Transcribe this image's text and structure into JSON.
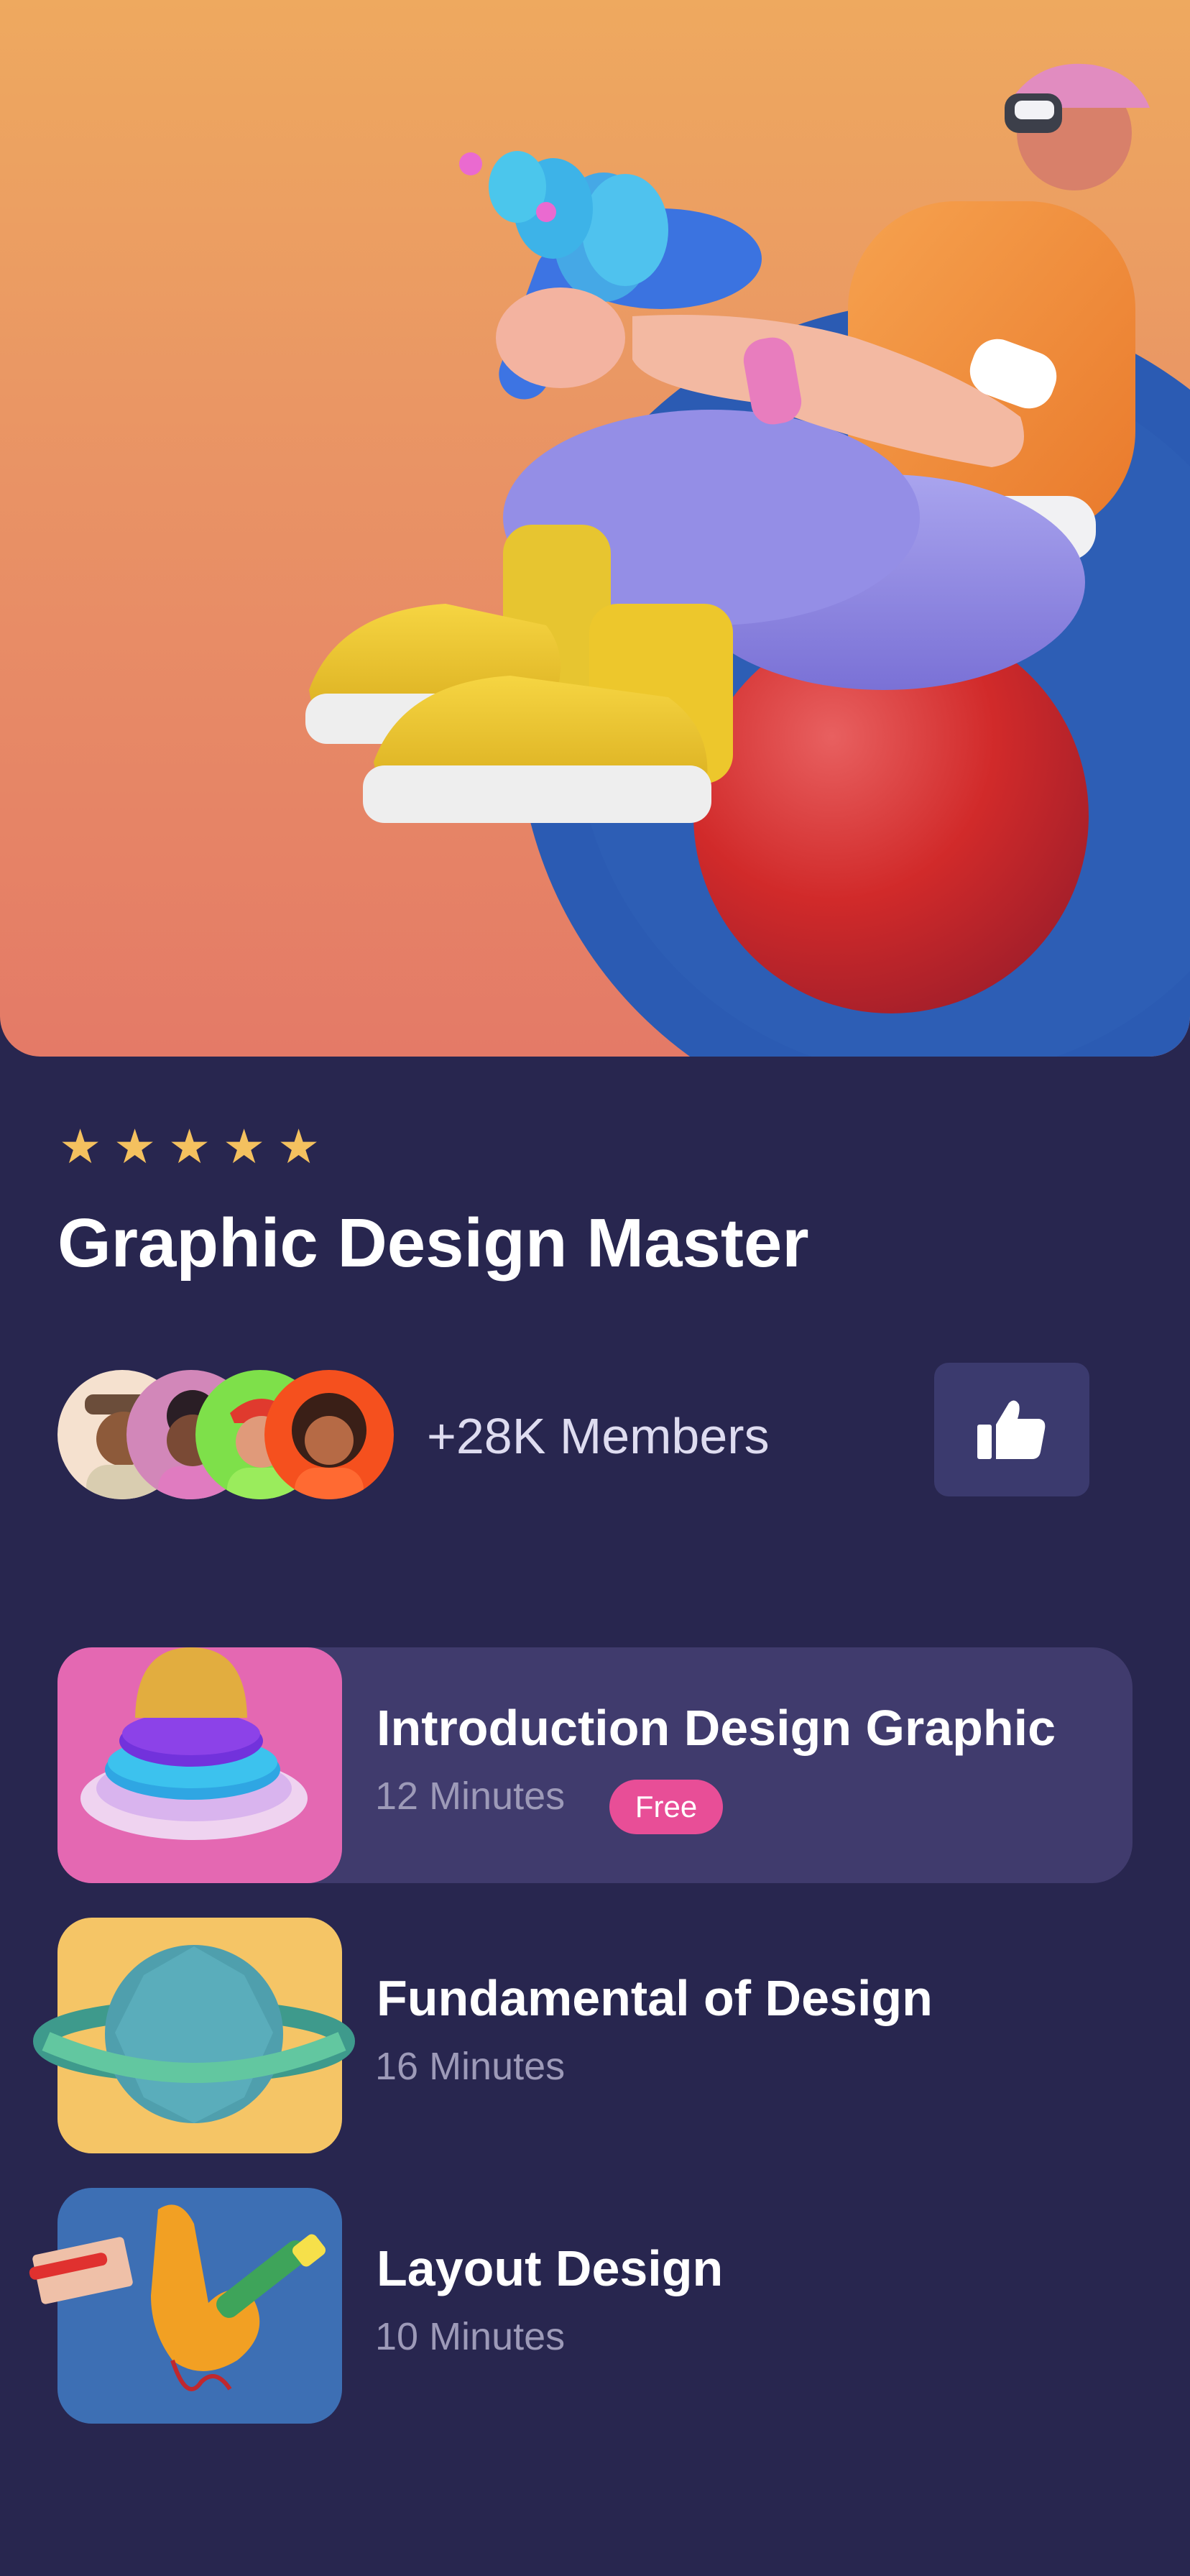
{
  "hero": {
    "image": "3d-character-with-blaster-on-ball"
  },
  "rating": {
    "stars": 5
  },
  "course": {
    "title": "Graphic Design Master",
    "members_label": "+28K Members"
  },
  "actions": {
    "like_icon": "thumbs-up-icon"
  },
  "lessons": [
    {
      "title": "Introduction Design Graphic",
      "duration": "12 Minutes",
      "badge": "Free",
      "thumb_color": "#e468b2",
      "thumb_icon": "stacked-rings-icon"
    },
    {
      "title": "Fundamental of Design",
      "duration": "16 Minutes",
      "thumb_color": "#f5c566",
      "thumb_icon": "planet-icon"
    },
    {
      "title": "Layout Design",
      "duration": "10 Minutes",
      "thumb_color": "#3d6fb4",
      "thumb_icon": "hand-pencil-icon"
    }
  ],
  "colors": {
    "background": "#28264f",
    "card": "#403b6d",
    "accent": "#e84e97",
    "star": "#f4c15f",
    "hero_top": "#eea95f",
    "hero_bottom": "#e47a67"
  }
}
